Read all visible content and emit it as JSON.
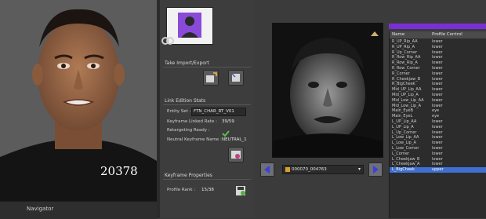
{
  "viewport": {
    "frame_number": "20378",
    "navigator_label": "Navigator"
  },
  "mid": {
    "take_section": "Take Import/Export",
    "link_section": "Link Edition Stats",
    "entity_label": "Entity Set :",
    "entity_value": "FTN_CHAR_RT_V01",
    "keyframe_linked_label": "Keyframe Linked Rate :",
    "keyframe_linked_value": "39/59",
    "retarget_label": "Retargeting Ready :",
    "neutral_label": "Neutral Keyframe Name :",
    "neutral_value": "NEUTRAL_1",
    "keyframe_props_section": "Keyframe Properties",
    "profile_rank_label": "Profile Rank :",
    "profile_rank_value": "15/38"
  },
  "take_select": {
    "value": "000070_004763"
  },
  "table": {
    "col_name": "Name",
    "col_profile": "Profile Control",
    "rows": [
      [
        "R_UP_Rip_AA",
        "lower"
      ],
      [
        "R_UP_Rip_A",
        "lower"
      ],
      [
        "R_Up_Corner",
        "lower"
      ],
      [
        "R_Row_Rip_AA",
        "lower"
      ],
      [
        "R_Row_Rip_A",
        "lower"
      ],
      [
        "R_Row_Corner",
        "lower"
      ],
      [
        "R_Corner",
        "lower"
      ],
      [
        "R_Cheekjaw_B",
        "lower"
      ],
      [
        "R_BigCheek",
        "lower"
      ],
      [
        "Mid_UP_Lip_AA",
        "lower"
      ],
      [
        "Mid_UP_Lip_A",
        "lower"
      ],
      [
        "Mid_Low_Lip_AA",
        "lower"
      ],
      [
        "Mid_Low_Lip_A",
        "lower"
      ],
      [
        "Main_EyeB",
        "eye"
      ],
      [
        "Main_EyeL",
        "eye"
      ],
      [
        "L_UP_Lip_AA",
        "lower"
      ],
      [
        "L_UP_Lip_A",
        "lower"
      ],
      [
        "L_Up_Corner",
        "lower"
      ],
      [
        "L_Low_Lip_AA",
        "lower"
      ],
      [
        "L_Low_Lip_A",
        "lower"
      ],
      [
        "L_Low_Corner",
        "lower"
      ],
      [
        "L_Corner",
        "lower"
      ],
      [
        "L_Cheekjaw_B",
        "lower"
      ],
      [
        "L_Cheekjaw_A",
        "lower"
      ],
      [
        "L_BigCheek",
        "upper"
      ]
    ]
  },
  "colors": {
    "accent": "#7a2fd6",
    "selection": "#3e6fd1"
  },
  "icons": [
    "actor-thumbnail-icon",
    "link-icon",
    "import-take-icon",
    "export-take-icon",
    "check-icon",
    "keyframe-settings-icon",
    "save-icon",
    "camera-icon",
    "prev-arrow-icon",
    "next-arrow-icon"
  ]
}
